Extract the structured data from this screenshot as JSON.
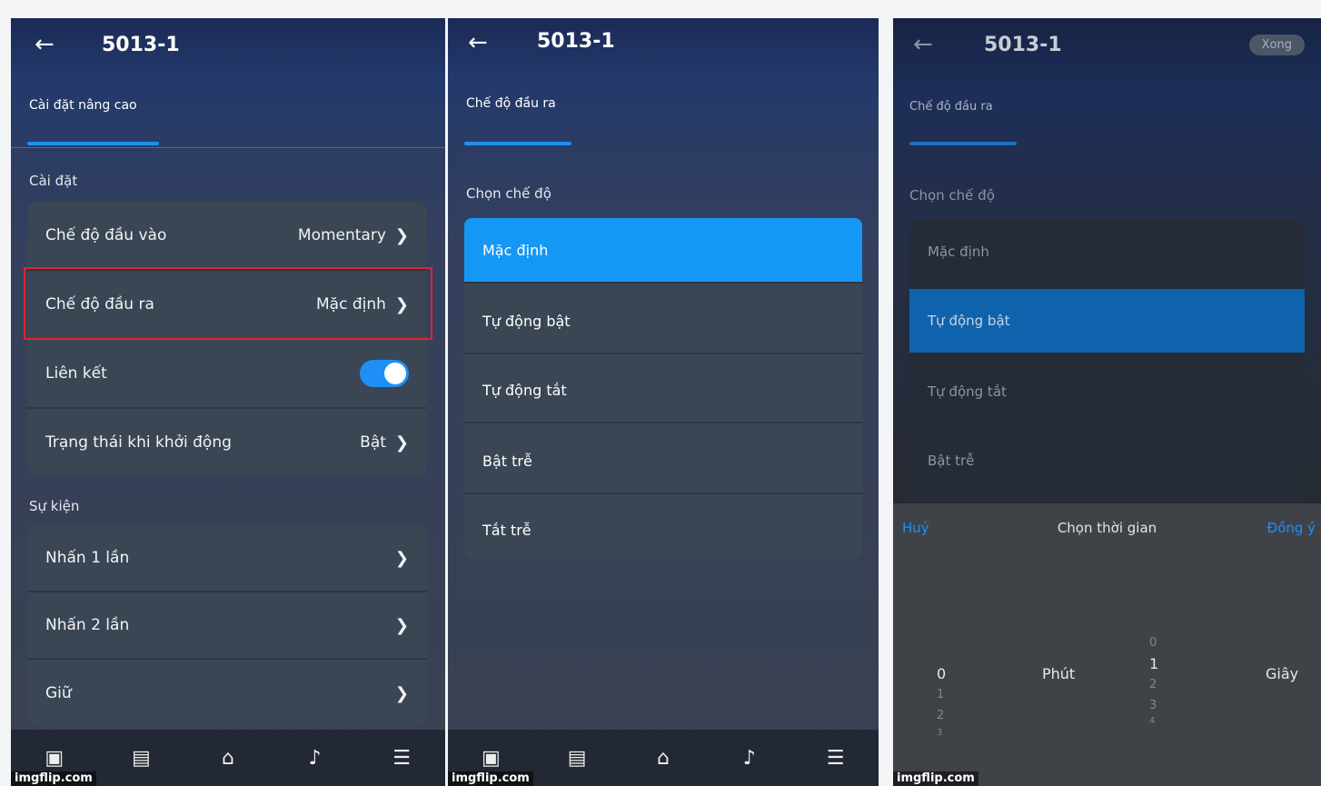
{
  "screen1": {
    "title": "5013-1",
    "tab": "Cài đặt nâng cao",
    "settings_header": "Cài đặt",
    "settings": [
      {
        "label": "Chế độ đầu vào",
        "value": "Momentary"
      },
      {
        "label": "Chế độ đầu ra",
        "value": "Mặc định"
      },
      {
        "label": "Liên kết",
        "value": ""
      },
      {
        "label": "Trạng thái khi khởi động",
        "value": "Bật"
      }
    ],
    "link_toggle_on": true,
    "events_header": "Sự kiện",
    "events": [
      {
        "label": "Nhấn 1 lần"
      },
      {
        "label": "Nhấn 2 lần"
      },
      {
        "label": "Giữ"
      }
    ]
  },
  "screen2": {
    "title": "5013-1",
    "tab": "Chế độ đầu ra",
    "section": "Chọn chế độ",
    "options": [
      "Mặc định",
      "Tự động bật",
      "Tự động tắt",
      "Bật trễ",
      "Tắt trễ"
    ],
    "selected": "Mặc định"
  },
  "screen3": {
    "title": "5013-1",
    "done": "Xong",
    "tab": "Chế độ đầu ra",
    "section": "Chọn chế độ",
    "options": [
      "Mặc định",
      "Tự động bật",
      "Tự động tắt",
      "Bật trễ"
    ],
    "selected": "Tự động bật",
    "picker": {
      "cancel": "Huỷ",
      "title": "Chọn thời gian",
      "ok": "Đồng ý",
      "minute_label": "Phút",
      "second_label": "Giây",
      "minutes_selected": "0",
      "minutes_below": [
        "1",
        "2",
        "3"
      ],
      "seconds_above": "0",
      "seconds_selected": "1",
      "seconds_below": [
        "2",
        "3",
        "4"
      ]
    }
  },
  "watermark": "imgflip.com",
  "nav_icons": [
    "dashboard-icon",
    "list-icon",
    "home-icon",
    "music-icon",
    "menu-icon"
  ]
}
